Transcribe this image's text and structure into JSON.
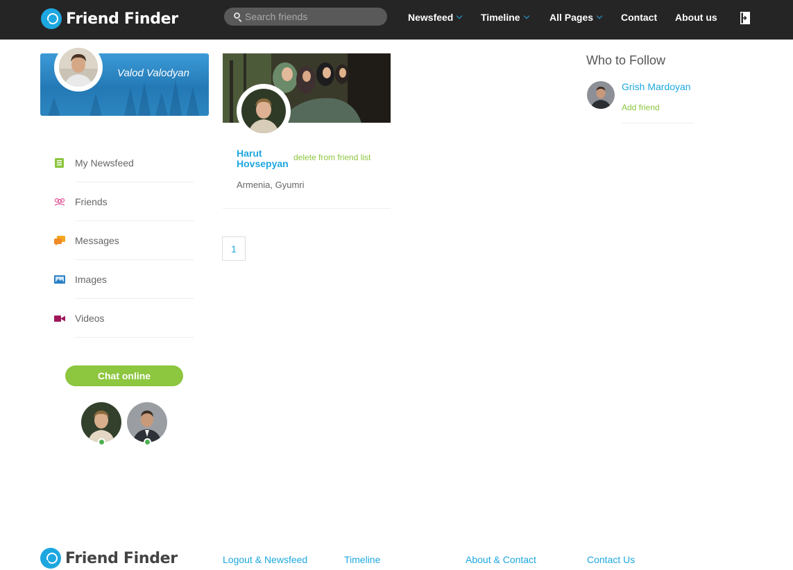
{
  "header": {
    "brand": "Friend Finder",
    "search_placeholder": "Search friends",
    "nav": [
      "Newsfeed",
      "Timeline",
      "All Pages",
      "Contact",
      "About us"
    ]
  },
  "profile": {
    "name": "Valod Valodyan"
  },
  "side_menu": [
    "My Newsfeed",
    "Friends",
    "Messages",
    "Images",
    "Videos"
  ],
  "chat": {
    "label": "Chat online"
  },
  "friend": {
    "name": "Harut Hovsepyan",
    "action": "delete from friend list",
    "location": "Armenia, Gyumri"
  },
  "pagination": {
    "page": "1"
  },
  "who_to_follow": {
    "title": "Who to Follow",
    "name": "Grish Mardoyan",
    "action": "Add friend"
  },
  "footer": {
    "brand": "Friend Finder",
    "links": [
      "Logout & Newsfeed",
      "Timeline",
      "About & Contact",
      "Contact Us"
    ]
  },
  "colors": {
    "accent": "#1da7e0",
    "green": "#8dc63f",
    "header_bg": "#262525"
  }
}
